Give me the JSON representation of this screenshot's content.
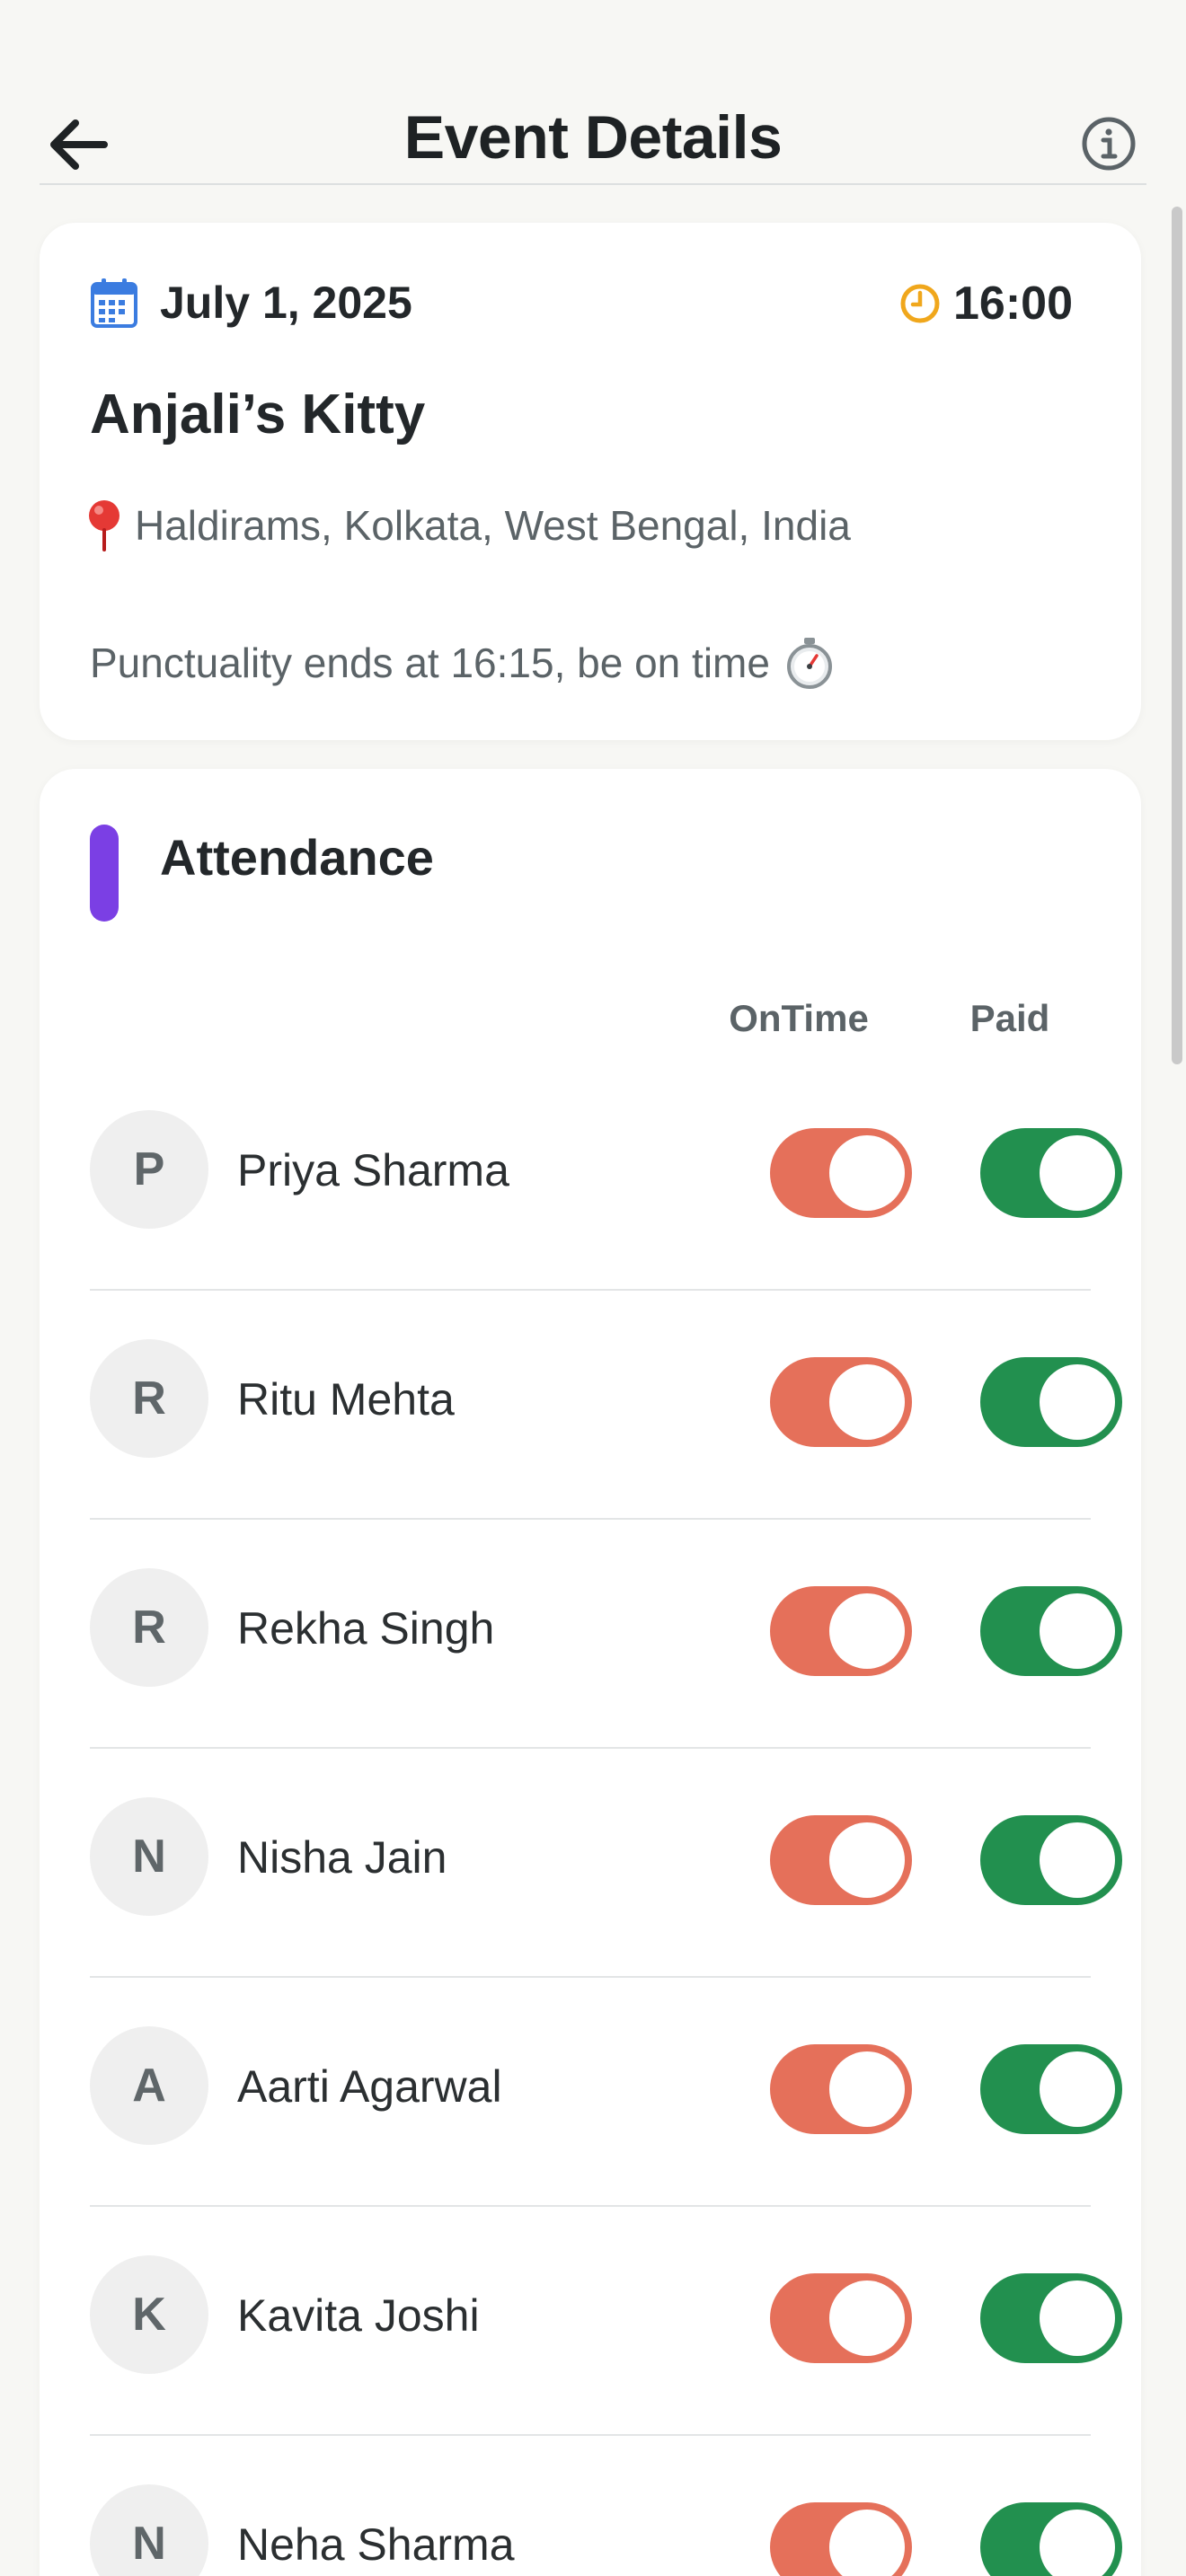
{
  "header": {
    "title": "Event Details"
  },
  "event": {
    "date": "July 1, 2025",
    "time": "16:00",
    "title": "Anjali’s Kitty",
    "location": "Haldirams, Kolkata, West Bengal, India",
    "punctuality_note": "Punctuality ends at 16:15, be on time"
  },
  "attendance": {
    "title": "Attendance",
    "col_ontime": "OnTime",
    "col_paid": "Paid",
    "members": [
      {
        "initial": "P",
        "name": "Priya Sharma",
        "ontime": true,
        "paid": true
      },
      {
        "initial": "R",
        "name": "Ritu Mehta",
        "ontime": true,
        "paid": true
      },
      {
        "initial": "R",
        "name": "Rekha Singh",
        "ontime": true,
        "paid": true
      },
      {
        "initial": "N",
        "name": "Nisha Jain",
        "ontime": true,
        "paid": true
      },
      {
        "initial": "A",
        "name": "Aarti Agarwal",
        "ontime": true,
        "paid": true
      },
      {
        "initial": "K",
        "name": "Kavita Joshi",
        "ontime": true,
        "paid": true
      },
      {
        "initial": "N",
        "name": "Neha Sharma",
        "ontime": true,
        "paid": true
      }
    ]
  },
  "colors": {
    "ontime_toggle": "#e5705a",
    "paid_toggle": "#22904f",
    "accent": "#7b3fe4",
    "calendar_icon": "#3b7ce0",
    "clock_icon": "#f0a71c",
    "pin_icon": "#e53935"
  },
  "icons": {
    "back": "arrow-left-icon",
    "info": "info-icon",
    "calendar": "calendar-icon",
    "clock": "clock-icon",
    "pin": "pin-icon",
    "stopwatch": "stopwatch-icon"
  }
}
